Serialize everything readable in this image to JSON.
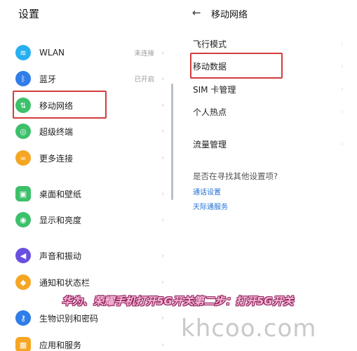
{
  "left": {
    "title": "设置",
    "items": [
      {
        "label": "WLAN",
        "status": "未连接",
        "icon": "wifi-icon",
        "color": "#27b0f0",
        "glyph": "≋"
      },
      {
        "label": "蓝牙",
        "status": "已开启",
        "icon": "bluetooth-icon",
        "color": "#2f7de8",
        "glyph": "ᛒ"
      },
      {
        "label": "移动网络",
        "status": "",
        "icon": "mobile-data-icon",
        "color": "#3cc06a",
        "glyph": "⇅"
      },
      {
        "label": "超级终端",
        "status": "",
        "icon": "super-device-icon",
        "color": "#3cc06a",
        "glyph": "◎"
      },
      {
        "label": "更多连接",
        "status": "",
        "icon": "link-icon",
        "color": "#f5a623",
        "glyph": "∞"
      },
      {
        "label": "桌面和壁纸",
        "status": "",
        "icon": "wallpaper-icon",
        "color": "#3cc06a",
        "glyph": "▣"
      },
      {
        "label": "显示和亮度",
        "status": "",
        "icon": "eye-icon",
        "color": "#3cc06a",
        "glyph": "◉"
      },
      {
        "label": "声音和振动",
        "status": "",
        "icon": "sound-icon",
        "color": "#6a4fe0",
        "glyph": "◀"
      },
      {
        "label": "通知和状态栏",
        "status": "",
        "icon": "bell-icon",
        "color": "#f5a623",
        "glyph": "◆"
      },
      {
        "label": "生物识别和密码",
        "status": "",
        "icon": "key-icon",
        "color": "#2f7de8",
        "glyph": "⚷"
      },
      {
        "label": "应用和服务",
        "status": "",
        "icon": "apps-icon",
        "color": "#f5a623",
        "glyph": "▦"
      }
    ],
    "chevron": "›"
  },
  "right": {
    "back": "←",
    "title": "移动网络",
    "items": [
      {
        "label": "飞行模式"
      },
      {
        "label": "移动数据"
      },
      {
        "label": "SIM 卡管理"
      },
      {
        "label": "个人热点"
      },
      {
        "label": "流量管理"
      }
    ],
    "question": "是否在寻找其他设置项?",
    "links": [
      "通话设置",
      "天际通服务"
    ]
  },
  "overlay": {
    "banner": "华为、荣耀手机打开5G开关第二步：打开5G开关",
    "watermark": "khcoo.com"
  },
  "colors": {
    "highlight": "#d53b3b",
    "link": "#1f6fd6"
  }
}
